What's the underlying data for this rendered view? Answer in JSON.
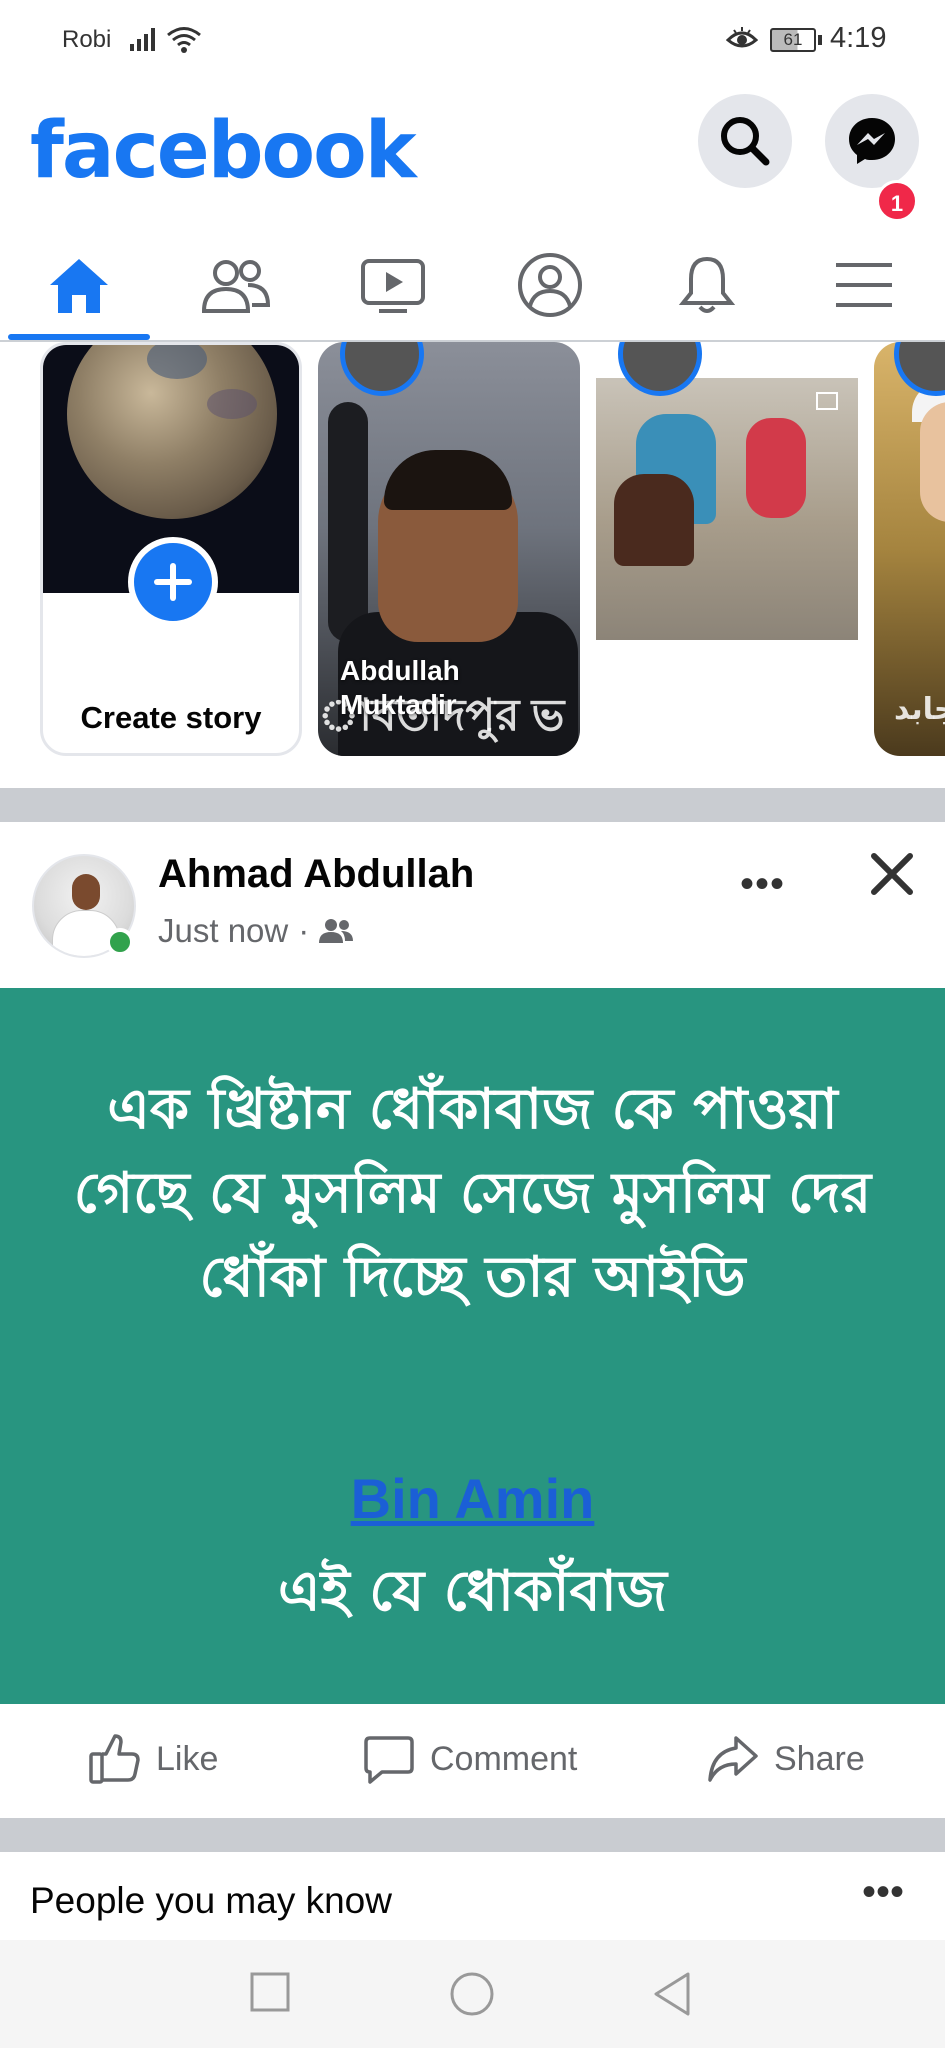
{
  "status_bar": {
    "carrier": "Robi",
    "battery": "61",
    "time": "4:19"
  },
  "header": {
    "logo": "facebook",
    "messenger_badge": "1"
  },
  "tabs": [
    {
      "name": "home",
      "active": true
    },
    {
      "name": "friends",
      "active": false
    },
    {
      "name": "watch",
      "active": false
    },
    {
      "name": "profile",
      "active": false
    },
    {
      "name": "notifications",
      "active": false
    },
    {
      "name": "menu",
      "active": false
    }
  ],
  "stories": {
    "create_label": "Create story",
    "items": [
      {
        "name": "Abdullah\nMuktadir",
        "overlay": "াবতাদপুর ভ"
      },
      {
        "name": "",
        "overlay": ""
      },
      {
        "name": "",
        "overlay": "جابد"
      }
    ]
  },
  "post": {
    "author": "Ahmad Abdullah",
    "time": "Just now",
    "separator": "·",
    "text": "এক খ্রিষ্টান ধোঁকাবাজ কে পাওয়া গেছে যে মুসলিম সেজে মুসলিম দের ধোঁকা দিচ্ছে তার আইডি",
    "mention": "Bin Amin",
    "text2": "এই যে ধোকাঁবাজ",
    "background_color": "#289580",
    "more": "•••"
  },
  "actions": {
    "like": "Like",
    "comment": "Comment",
    "share": "Share"
  },
  "pymk": {
    "title": "People you may know",
    "more": "•••"
  },
  "colors": {
    "brand": "#1877f2",
    "badge": "#f02849",
    "online": "#31a24c"
  }
}
